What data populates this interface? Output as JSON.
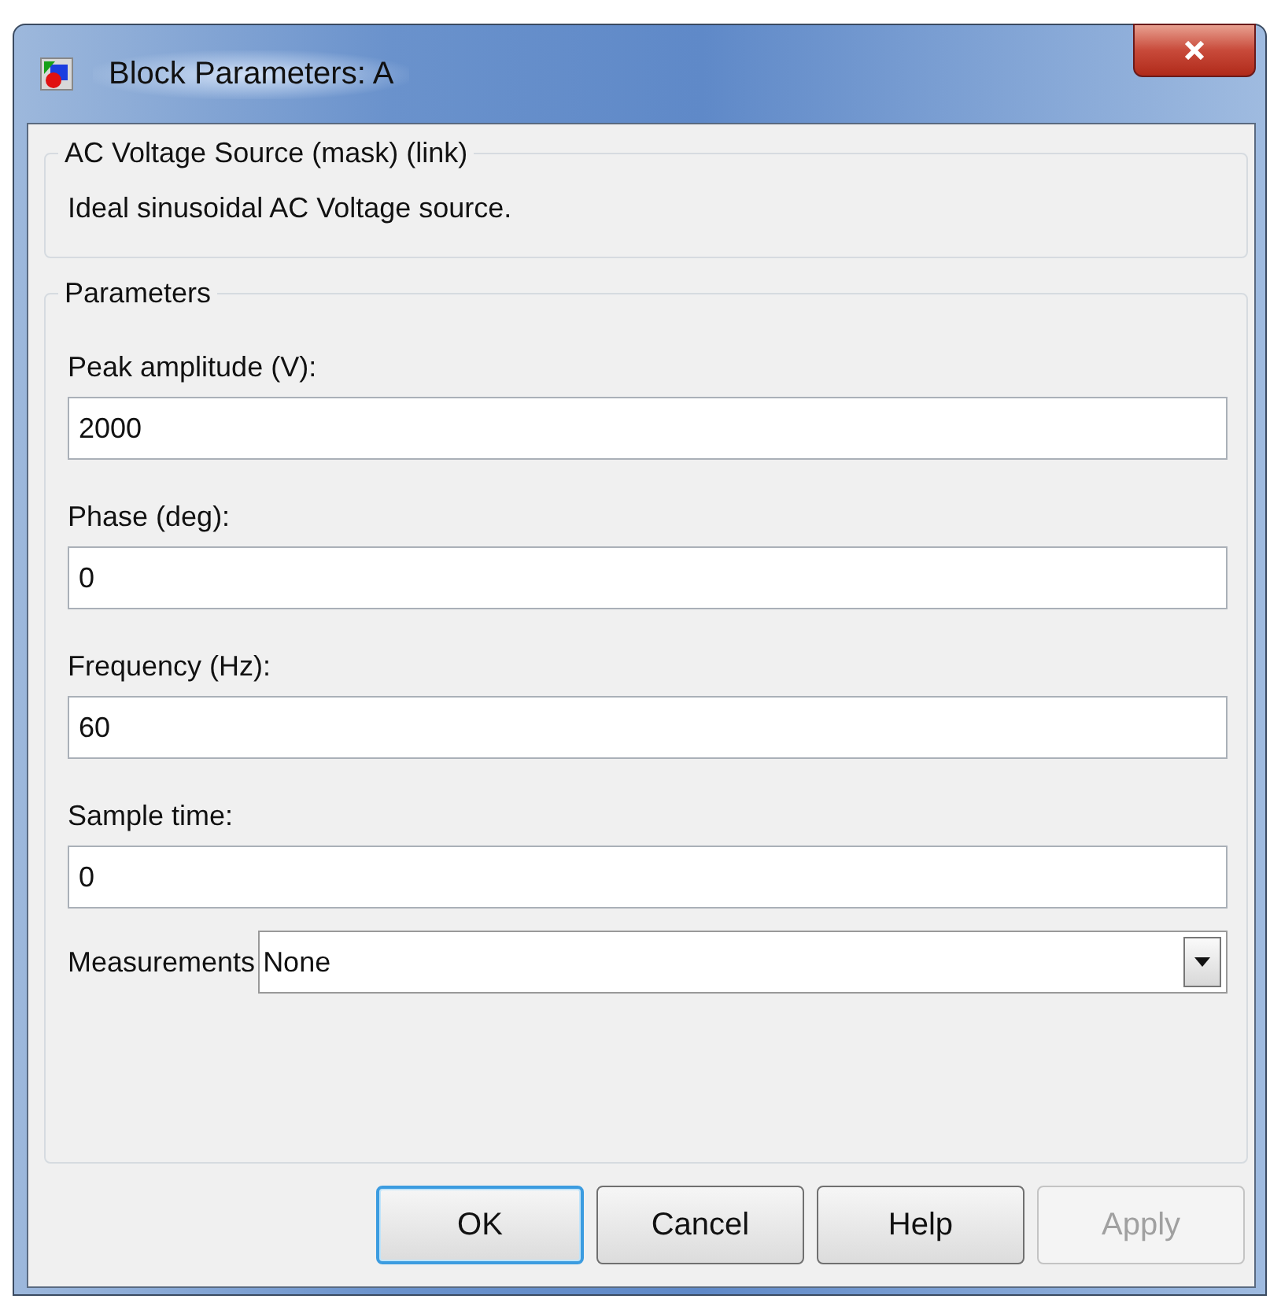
{
  "window": {
    "title": "Block Parameters: A"
  },
  "description_group": {
    "title": "AC Voltage Source (mask) (link)",
    "text": "Ideal sinusoidal AC Voltage source."
  },
  "parameters_group": {
    "title": "Parameters",
    "fields": [
      {
        "label": "Peak amplitude (V):",
        "value": "2000"
      },
      {
        "label": "Phase (deg):",
        "value": "0"
      },
      {
        "label": "Frequency (Hz):",
        "value": "60"
      },
      {
        "label": "Sample time:",
        "value": "0"
      }
    ],
    "measurements": {
      "label": "Measurements",
      "value": "None"
    }
  },
  "buttons": [
    {
      "label": "OK",
      "default": true,
      "disabled": false
    },
    {
      "label": "Cancel",
      "default": false,
      "disabled": false
    },
    {
      "label": "Help",
      "default": false,
      "disabled": false
    },
    {
      "label": "Apply",
      "default": false,
      "disabled": true
    }
  ]
}
